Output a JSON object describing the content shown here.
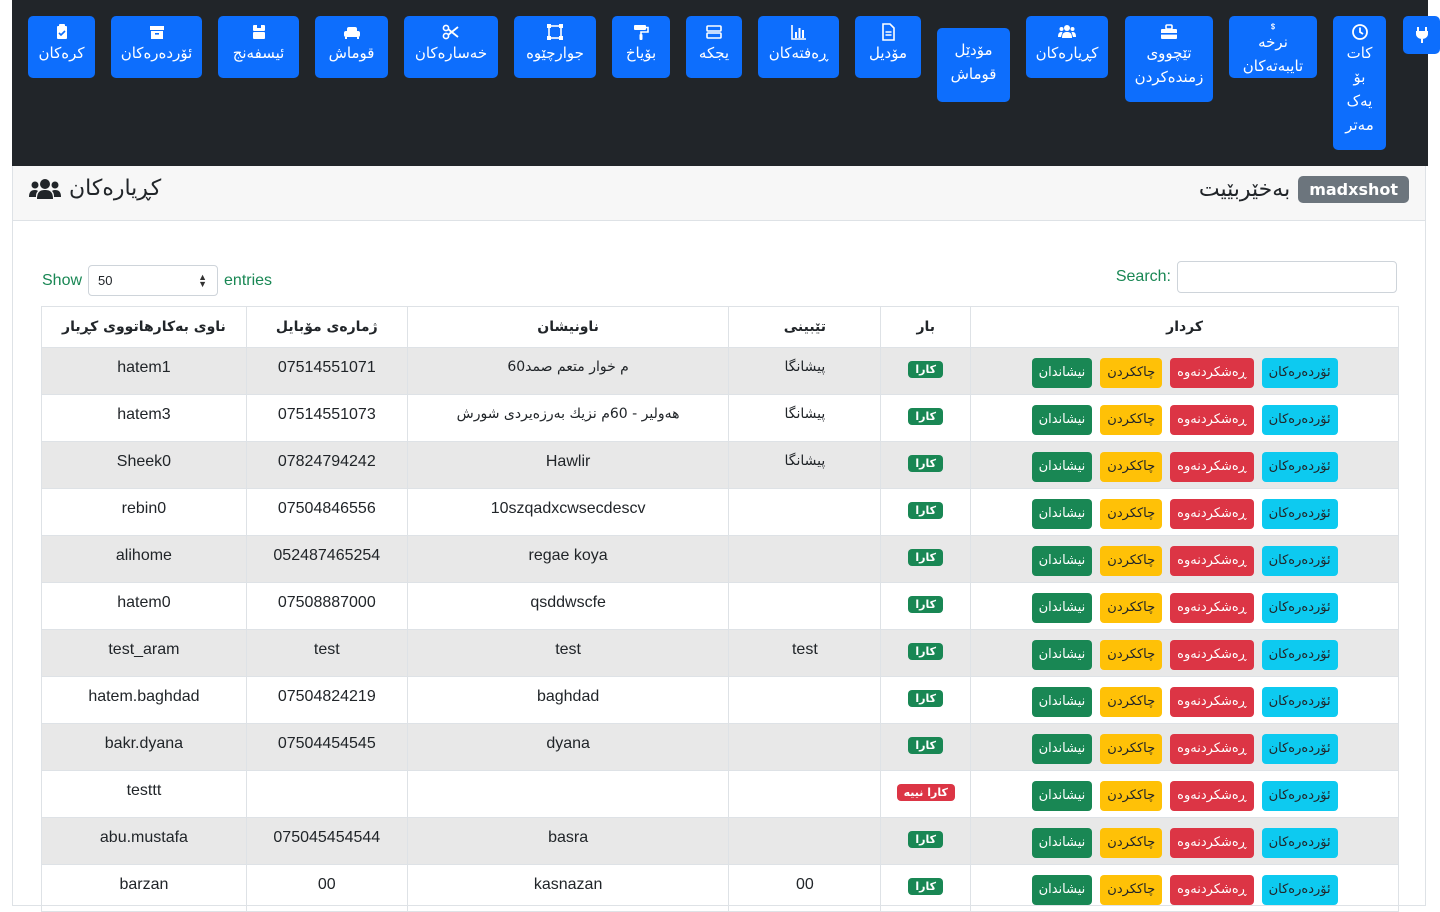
{
  "nav": {
    "items": [
      {
        "label": "کرەکان",
        "icon": "clipboard-check-icon"
      },
      {
        "label": "ئۆردەرەکان",
        "icon": "archive-icon"
      },
      {
        "label": "ئیسفەنج",
        "icon": "boxes-icon"
      },
      {
        "label": "قوماش",
        "icon": "couch-icon"
      },
      {
        "label": "خەسارەکان",
        "icon": "scissors-icon"
      },
      {
        "label": "جوارچێوە",
        "icon": "vector-square-icon"
      },
      {
        "label": "بۆیاخ",
        "icon": "paint-roller-icon"
      },
      {
        "label": "یجکە",
        "icon": "stack-icon"
      },
      {
        "label": "ڕەفتەکان",
        "icon": "chart-icon"
      },
      {
        "label": "مۆدیل",
        "icon": "file-icon"
      },
      {
        "label": "مۆدێل\nقوماش",
        "icon": "none"
      },
      {
        "label": "کڕیارەکان",
        "icon": "users-icon"
      },
      {
        "label": "تێچووی\nزمندەکردن",
        "icon": "toolbox-icon"
      },
      {
        "label": "نرخە\nتایبەتەکان",
        "icon": "dollar-icon"
      },
      {
        "label": "کات\nبۆ\nیەک\nمەتر",
        "icon": "clock-icon"
      },
      {
        "label": "",
        "icon": "plug-icon"
      }
    ]
  },
  "header": {
    "title": "کڕیارەکان",
    "title_icon": "users-icon",
    "welcome": "بەخێربێیت",
    "username": "madxshot"
  },
  "table_controls": {
    "show_label": "Show",
    "entries_label": "entries",
    "page_size": "50",
    "search_label": "Search:"
  },
  "columns": [
    "ناوی بەکارهاتووی کڕیار",
    "ژمارەی مۆبایل",
    "ناونیشان",
    "تێبینی",
    "بار",
    "کردار"
  ],
  "actions": {
    "show": "نیشاندان",
    "edit": "چاککردن",
    "delete": "ڕەشکردنەوە",
    "orders": "ئۆردەرەکان"
  },
  "status_labels": {
    "active": "کارا",
    "inactive": "کارا نییە"
  },
  "rows": [
    {
      "username": "hatem1",
      "phone": "07514551071",
      "address": "م خوار متعم صمد60",
      "note": "پیشانگا",
      "status": "active"
    },
    {
      "username": "hatem3",
      "phone": "07514551073",
      "address": "هەولیر - 60م نزيك بەرزەیردی شورش",
      "note": "پیشانگا",
      "status": "active"
    },
    {
      "username": "Sheek0",
      "phone": "07824794242",
      "address": "Hawlir",
      "note": "پیشانگا",
      "status": "active"
    },
    {
      "username": "rebin0",
      "phone": "07504846556",
      "address": "10szqadxcwsecdescv",
      "note": "",
      "status": "active"
    },
    {
      "username": "alihome",
      "phone": "052487465254",
      "address": "regae koya",
      "note": "",
      "status": "active"
    },
    {
      "username": "hatem0",
      "phone": "07508887000",
      "address": "qsddwscfe",
      "note": "",
      "status": "active"
    },
    {
      "username": "test_aram",
      "phone": "test",
      "address": "test",
      "note": "test",
      "status": "active"
    },
    {
      "username": "hatem.baghdad",
      "phone": "07504824219",
      "address": "baghdad",
      "note": "",
      "status": "active"
    },
    {
      "username": "bakr.dyana",
      "phone": "07504454545",
      "address": "dyana",
      "note": "",
      "status": "active"
    },
    {
      "username": "testtt",
      "phone": "",
      "address": "",
      "note": "",
      "status": "inactive"
    },
    {
      "username": "abu.mustafa",
      "phone": "075045454544",
      "address": "basra",
      "note": "",
      "status": "active"
    },
    {
      "username": "barzan",
      "phone": "00",
      "address": "kasnazan",
      "note": "00",
      "status": "active"
    }
  ],
  "colors": {
    "nav_bg": "#212529",
    "primary": "#0d6efd",
    "success": "#198754",
    "warning": "#ffc107",
    "danger": "#dc3545",
    "info": "#0dcaf0",
    "secondary": "#6c757d"
  }
}
